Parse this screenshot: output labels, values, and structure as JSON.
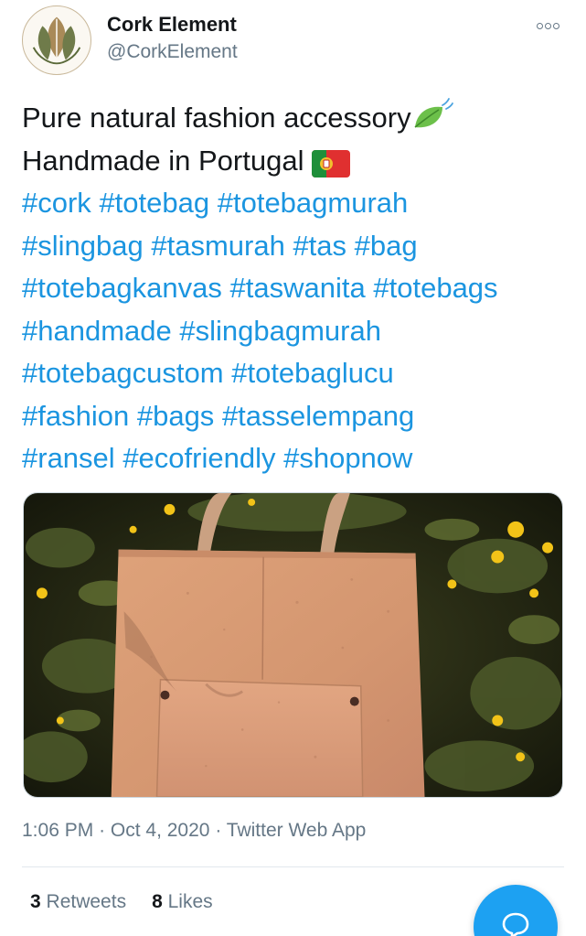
{
  "author": {
    "name": "Cork Element",
    "handle": "@CorkElement",
    "avatar_icon": "leaf-logo-icon"
  },
  "tweet": {
    "lines": [
      {
        "text": "Pure natural fashion accessory",
        "emoji": "leaf-fluttering-in-wind-icon"
      },
      {
        "text": "Handmade in Portugal",
        "emoji": "portugal-flag-icon"
      }
    ],
    "hashtag_lines": [
      [
        "#cork",
        "#totebag",
        "#totebagmurah"
      ],
      [
        "#slingbag",
        "#tasmurah",
        "#tas",
        "#bag"
      ],
      [
        "#totebagkanvas",
        "#taswanita",
        "#totebags"
      ],
      [
        "#handmade",
        "#slingbagmurah"
      ],
      [
        "#totebagcustom",
        "#totebaglucu"
      ],
      [
        "#fashion",
        "#bags",
        "#tasselempang"
      ],
      [
        "#ransel",
        "#ecofriendly",
        "#shopnow"
      ]
    ]
  },
  "meta": {
    "time": "1:06 PM",
    "separator": "·",
    "date": "Oct 4, 2020",
    "source": "Twitter Web App"
  },
  "stats": {
    "retweets_count": "3",
    "retweets_label": "Retweets",
    "likes_count": "8",
    "likes_label": "Likes"
  },
  "fab_icon": "reply-bubble-icon",
  "colors": {
    "link": "#1b95e0",
    "primary_text": "#14171a",
    "secondary_text": "#657786",
    "accent": "#1da1f2"
  }
}
